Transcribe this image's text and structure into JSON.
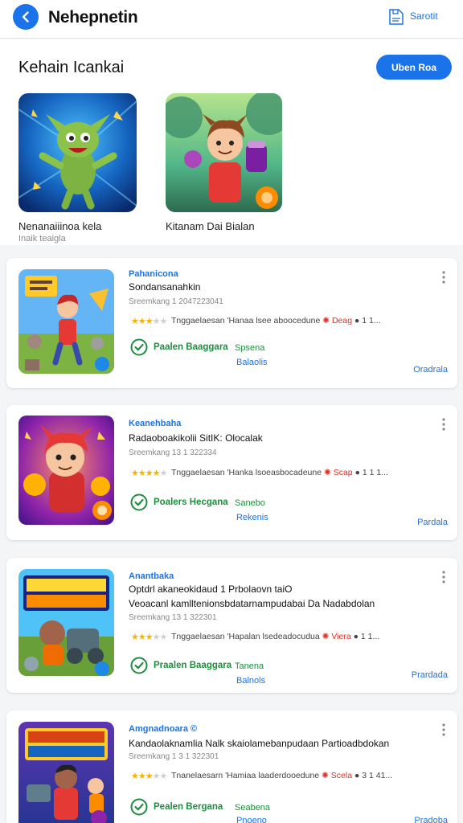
{
  "header": {
    "title": "Nehepnetin",
    "save_label": "Sarotit"
  },
  "featured": {
    "heading": "Kehain Icankai",
    "button_label": "Uben Roa",
    "items": [
      {
        "name": "Nenanaiiinoa kela",
        "sub": "Inaik teaigla"
      },
      {
        "name": "Kitanam Dai Bialan",
        "sub": ""
      }
    ]
  },
  "cards": [
    {
      "category": "Pahanicona",
      "title": "Sondansanahkin",
      "subtitle": "",
      "date": "Sreemkang 1 2047223041",
      "rating": 3,
      "meta_text": "Tnggaelaesan 'Hanaa lsee aboocedune",
      "meta_highlight": "✺ Deag",
      "meta_tail": "● 1 1...",
      "status": "Paalen Baaggara",
      "tag": "Spsena",
      "tag2": "Balaolis",
      "link": "Oradrala"
    },
    {
      "category": "Keanehbaha",
      "title": "Radaoboakikolii SitIK: Olocalak",
      "subtitle": "",
      "date": "Sreemkang 13 1 322334",
      "rating": 4,
      "meta_text": "Tnggaelaesan 'Hanka lsoeasbocadeune",
      "meta_highlight": "✺ Scap",
      "meta_tail": "● 1 1 1...",
      "status": "Poalers Hecgana",
      "tag": "Sanebo",
      "tag2": "Rekenis",
      "link": "Pardala"
    },
    {
      "category": "Anantbaka",
      "title": "Optdrl akaneokidaud 1 Prbolaovn taiO",
      "subtitle": "Veoacanl kamlltenionsbdatarnampudabai Da Nadabdolan",
      "date": "Sreemkang 13 1 322301",
      "rating": 3,
      "meta_text": "Tnggaelaesan 'Hapalan lsedeadocudua",
      "meta_highlight": "✺ Viera",
      "meta_tail": "● 1 1...",
      "status": "Praalen Baaggara",
      "tag": "Tanena",
      "tag2": "Balnols",
      "link": "Prardada"
    },
    {
      "category": "Amgnadnoara ©",
      "title": "Kandaolaknamlia Nalk skaiolamebanpudaan Partioadbdokan",
      "subtitle": "",
      "date": "Sreemkang 1 3 1 322301",
      "rating": 3,
      "meta_text": "Tnanelaesarn 'Hamiaa laaderdooedune",
      "meta_highlight": "✺ Scela",
      "meta_tail": "● 3 1 41...",
      "status": "Pealen Bergana",
      "tag": "Seabena",
      "tag2": "Pnoeno",
      "link": "Pradoba"
    }
  ],
  "colors": {
    "accent": "#1a73e8",
    "success": "#1e8e3e",
    "star": "#f4b400",
    "highlight": "#d93025"
  },
  "icons": [
    "back-arrow-icon",
    "save-document-icon",
    "check-circle-icon",
    "more-vertical-icon",
    "star-icon"
  ]
}
